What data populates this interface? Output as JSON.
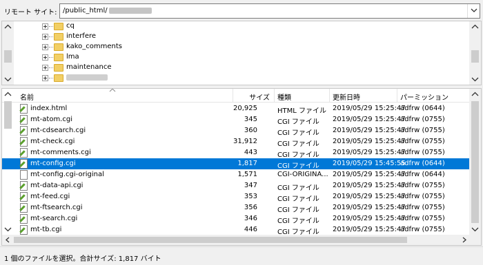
{
  "remote_site": {
    "label": "リモート サイト:",
    "path": "/public_html/"
  },
  "tree": {
    "items": [
      {
        "label": "cq",
        "icon": "folder-icon"
      },
      {
        "label": "interfere",
        "icon": "folder-icon"
      },
      {
        "label": "kako_comments",
        "icon": "folder-icon"
      },
      {
        "label": "lma",
        "icon": "folder-icon"
      },
      {
        "label": "maintenance",
        "icon": "folder-icon"
      },
      {
        "label": "",
        "icon": "folder-icon"
      }
    ]
  },
  "file_list": {
    "columns": {
      "name": "名前",
      "size": "サイズ",
      "type": "種類",
      "modified": "更新日時",
      "permissions": "パーミッション"
    },
    "rows": [
      {
        "name": "index.html",
        "size": "20,925",
        "type": "HTML ファイル",
        "modified": "2019/05/29 15:25:47",
        "permissions": "adfrw (0644)"
      },
      {
        "name": "mt-atom.cgi",
        "size": "345",
        "type": "CGI ファイル",
        "modified": "2019/05/29 15:25:47",
        "permissions": "adfrw (0755)"
      },
      {
        "name": "mt-cdsearch.cgi",
        "size": "360",
        "type": "CGI ファイル",
        "modified": "2019/05/29 15:25:47",
        "permissions": "adfrw (0755)"
      },
      {
        "name": "mt-check.cgi",
        "size": "31,912",
        "type": "CGI ファイル",
        "modified": "2019/05/29 15:25:47",
        "permissions": "adfrw (0755)"
      },
      {
        "name": "mt-comments.cgi",
        "size": "443",
        "type": "CGI ファイル",
        "modified": "2019/05/29 15:25:47",
        "permissions": "adfrw (0755)"
      },
      {
        "name": "mt-config.cgi",
        "size": "1,817",
        "type": "CGI ファイル",
        "modified": "2019/05/29 15:45:55",
        "permissions": "adfrw (0644)"
      },
      {
        "name": "mt-config.cgi-original",
        "size": "1,571",
        "type": "CGI-ORIGINA...",
        "modified": "2019/05/29 15:25:47",
        "permissions": "adfrw (0644)"
      },
      {
        "name": "mt-data-api.cgi",
        "size": "347",
        "type": "CGI ファイル",
        "modified": "2019/05/29 15:25:47",
        "permissions": "adfrw (0755)"
      },
      {
        "name": "mt-feed.cgi",
        "size": "353",
        "type": "CGI ファイル",
        "modified": "2019/05/29 15:25:47",
        "permissions": "adfrw (0755)"
      },
      {
        "name": "mt-ftsearch.cgi",
        "size": "356",
        "type": "CGI ファイル",
        "modified": "2019/05/29 15:25:47",
        "permissions": "adfrw (0755)"
      },
      {
        "name": "mt-search.cgi",
        "size": "346",
        "type": "CGI ファイル",
        "modified": "2019/05/29 15:25:47",
        "permissions": "adfrw (0755)"
      },
      {
        "name": "mt-tb.cgi",
        "size": "446",
        "type": "CGI ファイル",
        "modified": "2019/05/29 15:25:47",
        "permissions": "adfrw (0755)"
      }
    ]
  },
  "status": {
    "text": "1 個のファイルを選択。合計サイズ: 1,817 バイト"
  },
  "colors": {
    "selection": "#0078d7",
    "folder": "#f2cf65"
  }
}
